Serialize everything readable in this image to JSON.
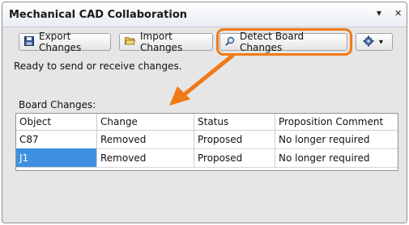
{
  "window": {
    "title": "Mechanical CAD Collaboration",
    "pin_glyph": "▾",
    "pin_glyph2": "⊕",
    "close_glyph": "✕"
  },
  "toolbar": {
    "export_label": "Export Changes",
    "import_label": "Import Changes",
    "detect_label": "Detect Board Changes",
    "settings_caret": "▾"
  },
  "status_text": "Ready to send or receive changes.",
  "board_changes": {
    "label": "Board Changes:",
    "columns": [
      "Object",
      "Change",
      "Status",
      "Proposition Comment"
    ],
    "rows": [
      {
        "object": "C87",
        "change": "Removed",
        "status": "Proposed",
        "comment": "No longer required"
      },
      {
        "object": "J1",
        "change": "Removed",
        "status": "Proposed",
        "comment": "No longer required"
      }
    ]
  },
  "colors": {
    "highlight": "#f07a17",
    "selection": "#3f8fe0"
  }
}
